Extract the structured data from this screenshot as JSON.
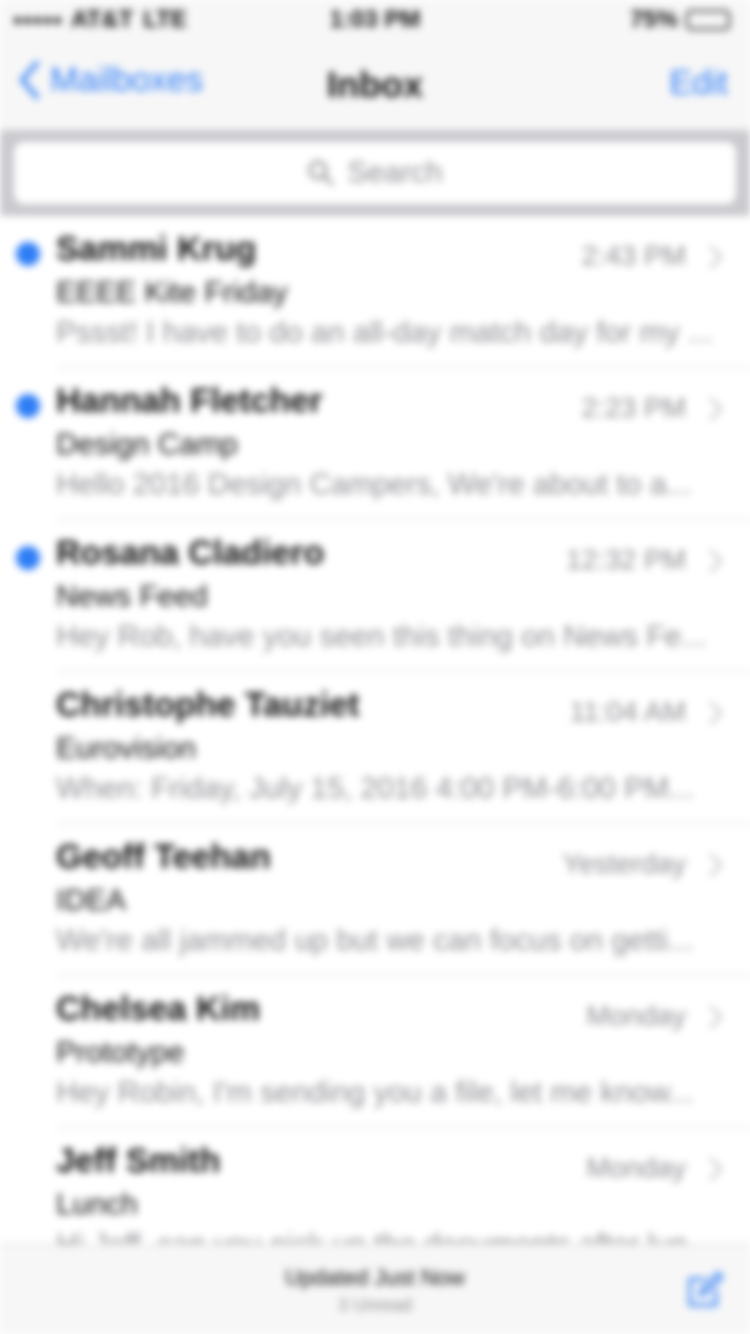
{
  "status_bar": {
    "carrier": "AT&T",
    "network": "LTE",
    "time": "1:03 PM",
    "battery": "75%",
    "battery_level": 0.75
  },
  "nav": {
    "back_label": "Mailboxes",
    "title": "Inbox",
    "edit_label": "Edit"
  },
  "search": {
    "placeholder": "Search"
  },
  "messages": [
    {
      "sender": "Sammi Krug",
      "subject": "EEEE Kite Friday",
      "preview": "Pssst! I have to do an all-day match day for my ...",
      "time": "2:43 PM",
      "unread": true
    },
    {
      "sender": "Hannah Fletcher",
      "subject": "Design Camp",
      "preview": "Hello 2016 Design Campers, We're about to a...",
      "time": "2:23 PM",
      "unread": true
    },
    {
      "sender": "Rosana Cladiero",
      "subject": "News Feed",
      "preview": "Hey Rob, have you seen this thing on News Fe...",
      "time": "12:32 PM",
      "unread": true
    },
    {
      "sender": "Christophe Tauziet",
      "subject": "Eurovision",
      "preview": "When: Friday, July 15, 2016 4:00 PM-6:00 PM...",
      "time": "11:04 AM",
      "unread": false
    },
    {
      "sender": "Geoff Teehan",
      "subject": "IDEA",
      "preview": "We're all jammed up but we can focus on getti...",
      "time": "Yesterday",
      "unread": false
    },
    {
      "sender": "Chelsea Kim",
      "subject": "Prototype",
      "preview": "Hey Robin, I'm sending you a file, let me know...",
      "time": "Monday",
      "unread": false
    },
    {
      "sender": "Jeff Smith",
      "subject": "Lunch",
      "preview": "Hi Jeff, can you pick up the documents after lunch...",
      "time": "Monday",
      "unread": false
    }
  ],
  "toolbar": {
    "status": "Updated Just Now",
    "subtitle": "3 Unread"
  },
  "colors": {
    "accent": "#2f7df6",
    "secondary_text": "#8e8e93",
    "bar_background": "#f7f7f7"
  }
}
